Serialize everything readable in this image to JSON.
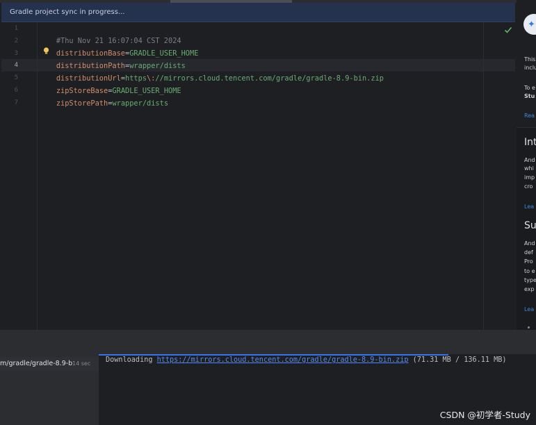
{
  "banner": {
    "text": "Gradle project sync in progress..."
  },
  "editor": {
    "line_numbers": [
      "1",
      "2",
      "3",
      "4",
      "5",
      "6",
      "7"
    ],
    "lines": [
      {
        "comment": "#Thu Nov 21 16:07:04 CST 2024"
      },
      {
        "key": "distributionBase",
        "eq": "=",
        "value": "GRADLE_USER_HOME"
      },
      {
        "key": "distributionPath",
        "eq": "=",
        "value": "wrapper/dists"
      },
      {
        "key": "distributionUrl",
        "eq": "=",
        "value_a": "https",
        "esc": "\\:",
        "value_b": "//mirrors.cloud.tencent.com/gradle/gradle-8.9-bin.zip"
      },
      {
        "key": "zipStoreBase",
        "eq": "=",
        "value": "GRADLE_USER_HOME"
      },
      {
        "key": "zipStorePath",
        "eq": "=",
        "value": "wrapper/dists"
      }
    ],
    "status_icon": "check-icon",
    "hint_icon": "lightbulb-icon"
  },
  "right_panel": {
    "logo_icon": "android-studio-logo-icon",
    "para1_line1": "This",
    "para1_line2": "inclu",
    "para2_line1": "To e",
    "para2_line2": "Stu",
    "link1": "Rea",
    "heading1": "Int",
    "sec1_lines": [
      "And",
      "whi",
      "imp",
      "cro"
    ],
    "link2": "Lea",
    "heading2": "Su",
    "sec2_lines": [
      "And",
      "def",
      "Pro",
      "to e",
      "type",
      "exp"
    ],
    "link3": "Lea"
  },
  "build": {
    "path": "m/gradle/gradle-8.9-b",
    "time": "14 sec"
  },
  "console": {
    "prefix": "Downloading ",
    "url": "https://mirrors.cloud.tencent.com/gradle/gradle-8.9-bin.zip",
    "suffix": " (71.31 MB / 136.11 MB)"
  },
  "watermark": "CSDN @初学者-Study",
  "colors": {
    "accent": "#3574f0",
    "banner_bg": "#25324d",
    "key": "#cf8e6d",
    "value": "#6aab73",
    "comment": "#7a7e85"
  }
}
